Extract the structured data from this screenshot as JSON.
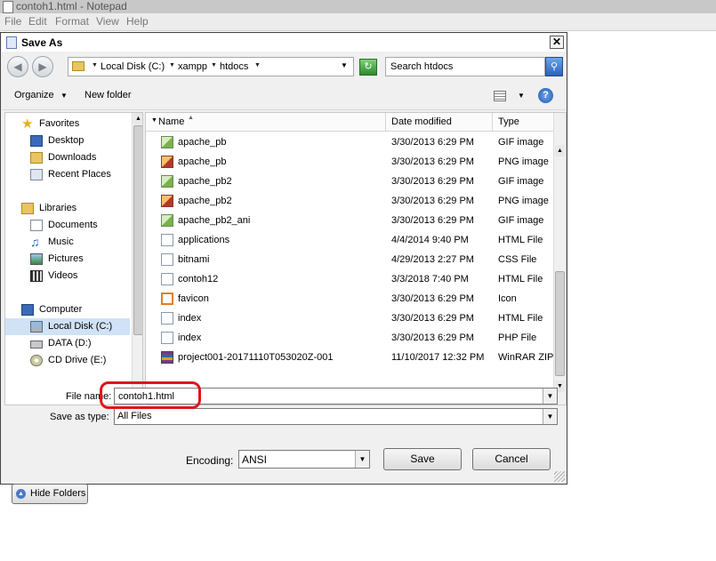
{
  "notepad": {
    "title": "contoh1.html - Notepad",
    "menu": [
      "File",
      "Edit",
      "Format",
      "View",
      "Help"
    ]
  },
  "dialog": {
    "title": "Save As",
    "close_glyph": "✕"
  },
  "address_bar": {
    "crumbs": [
      "Local Disk (C:)",
      "xampp",
      "htdocs"
    ]
  },
  "search": {
    "placeholder": "Search htdocs"
  },
  "toolbar": {
    "organize_label": "Organize",
    "new_folder_label": "New folder",
    "help_glyph": "?"
  },
  "nav_pane": {
    "items": [
      {
        "label": "Favorites",
        "icon": "star-icon"
      },
      {
        "label": "Desktop",
        "icon": "desktop-icon"
      },
      {
        "label": "Downloads",
        "icon": "downloads-icon"
      },
      {
        "label": "Recent Places",
        "icon": "recent-places-icon"
      },
      {
        "label": "Libraries",
        "icon": "libraries-icon"
      },
      {
        "label": "Documents",
        "icon": "documents-icon"
      },
      {
        "label": "Music",
        "icon": "music-icon"
      },
      {
        "label": "Pictures",
        "icon": "pictures-icon"
      },
      {
        "label": "Videos",
        "icon": "videos-icon"
      },
      {
        "label": "Computer",
        "icon": "computer-icon"
      },
      {
        "label": "Local Disk (C:)",
        "icon": "local-disk-icon",
        "selected": true
      },
      {
        "label": "DATA (D:)",
        "icon": "drive-icon"
      },
      {
        "label": "CD Drive (E:)",
        "icon": "cd-drive-icon"
      }
    ]
  },
  "file_list": {
    "columns": [
      "Name",
      "Date modified",
      "Type"
    ],
    "rows": [
      {
        "name": "apache_pb",
        "date": "3/30/2013 6:29 PM",
        "type": "GIF image",
        "icon": "gif-image-icon"
      },
      {
        "name": "apache_pb",
        "date": "3/30/2013 6:29 PM",
        "type": "PNG image",
        "icon": "png-image-icon"
      },
      {
        "name": "apache_pb2",
        "date": "3/30/2013 6:29 PM",
        "type": "GIF image",
        "icon": "gif-image-icon"
      },
      {
        "name": "apache_pb2",
        "date": "3/30/2013 6:29 PM",
        "type": "PNG image",
        "icon": "png-image-icon"
      },
      {
        "name": "apache_pb2_ani",
        "date": "3/30/2013 6:29 PM",
        "type": "GIF image",
        "icon": "gif-image-icon"
      },
      {
        "name": "applications",
        "date": "4/4/2014 9:40 PM",
        "type": "HTML File",
        "icon": "html-file-icon"
      },
      {
        "name": "bitnami",
        "date": "4/29/2013 2:27 PM",
        "type": "CSS File",
        "icon": "css-file-icon"
      },
      {
        "name": "contoh12",
        "date": "3/3/2018 7:40 PM",
        "type": "HTML File",
        "icon": "html-file-icon"
      },
      {
        "name": "favicon",
        "date": "3/30/2013 6:29 PM",
        "type": "Icon",
        "icon": "favicon-icon"
      },
      {
        "name": "index",
        "date": "3/30/2013 6:29 PM",
        "type": "HTML File",
        "icon": "html-file-icon"
      },
      {
        "name": "index",
        "date": "3/30/2013 6:29 PM",
        "type": "PHP File",
        "icon": "php-file-icon"
      },
      {
        "name": "project001-20171110T053020Z-001",
        "date": "11/10/2017 12:32 PM",
        "type": "WinRAR ZIP",
        "icon": "winrar-icon"
      }
    ]
  },
  "form": {
    "file_name_label": "File name:",
    "file_name_value": "contoh1.html",
    "save_type_label": "Save as type:",
    "save_type_value": "All Files",
    "encoding_label": "Encoding:",
    "encoding_value": "ANSI"
  },
  "buttons": {
    "hide_folders": "Hide Folders",
    "save": "Save",
    "cancel": "Cancel"
  },
  "colors": {
    "highlight": "#e0141a",
    "selected_nav": "#cfe2f6"
  }
}
